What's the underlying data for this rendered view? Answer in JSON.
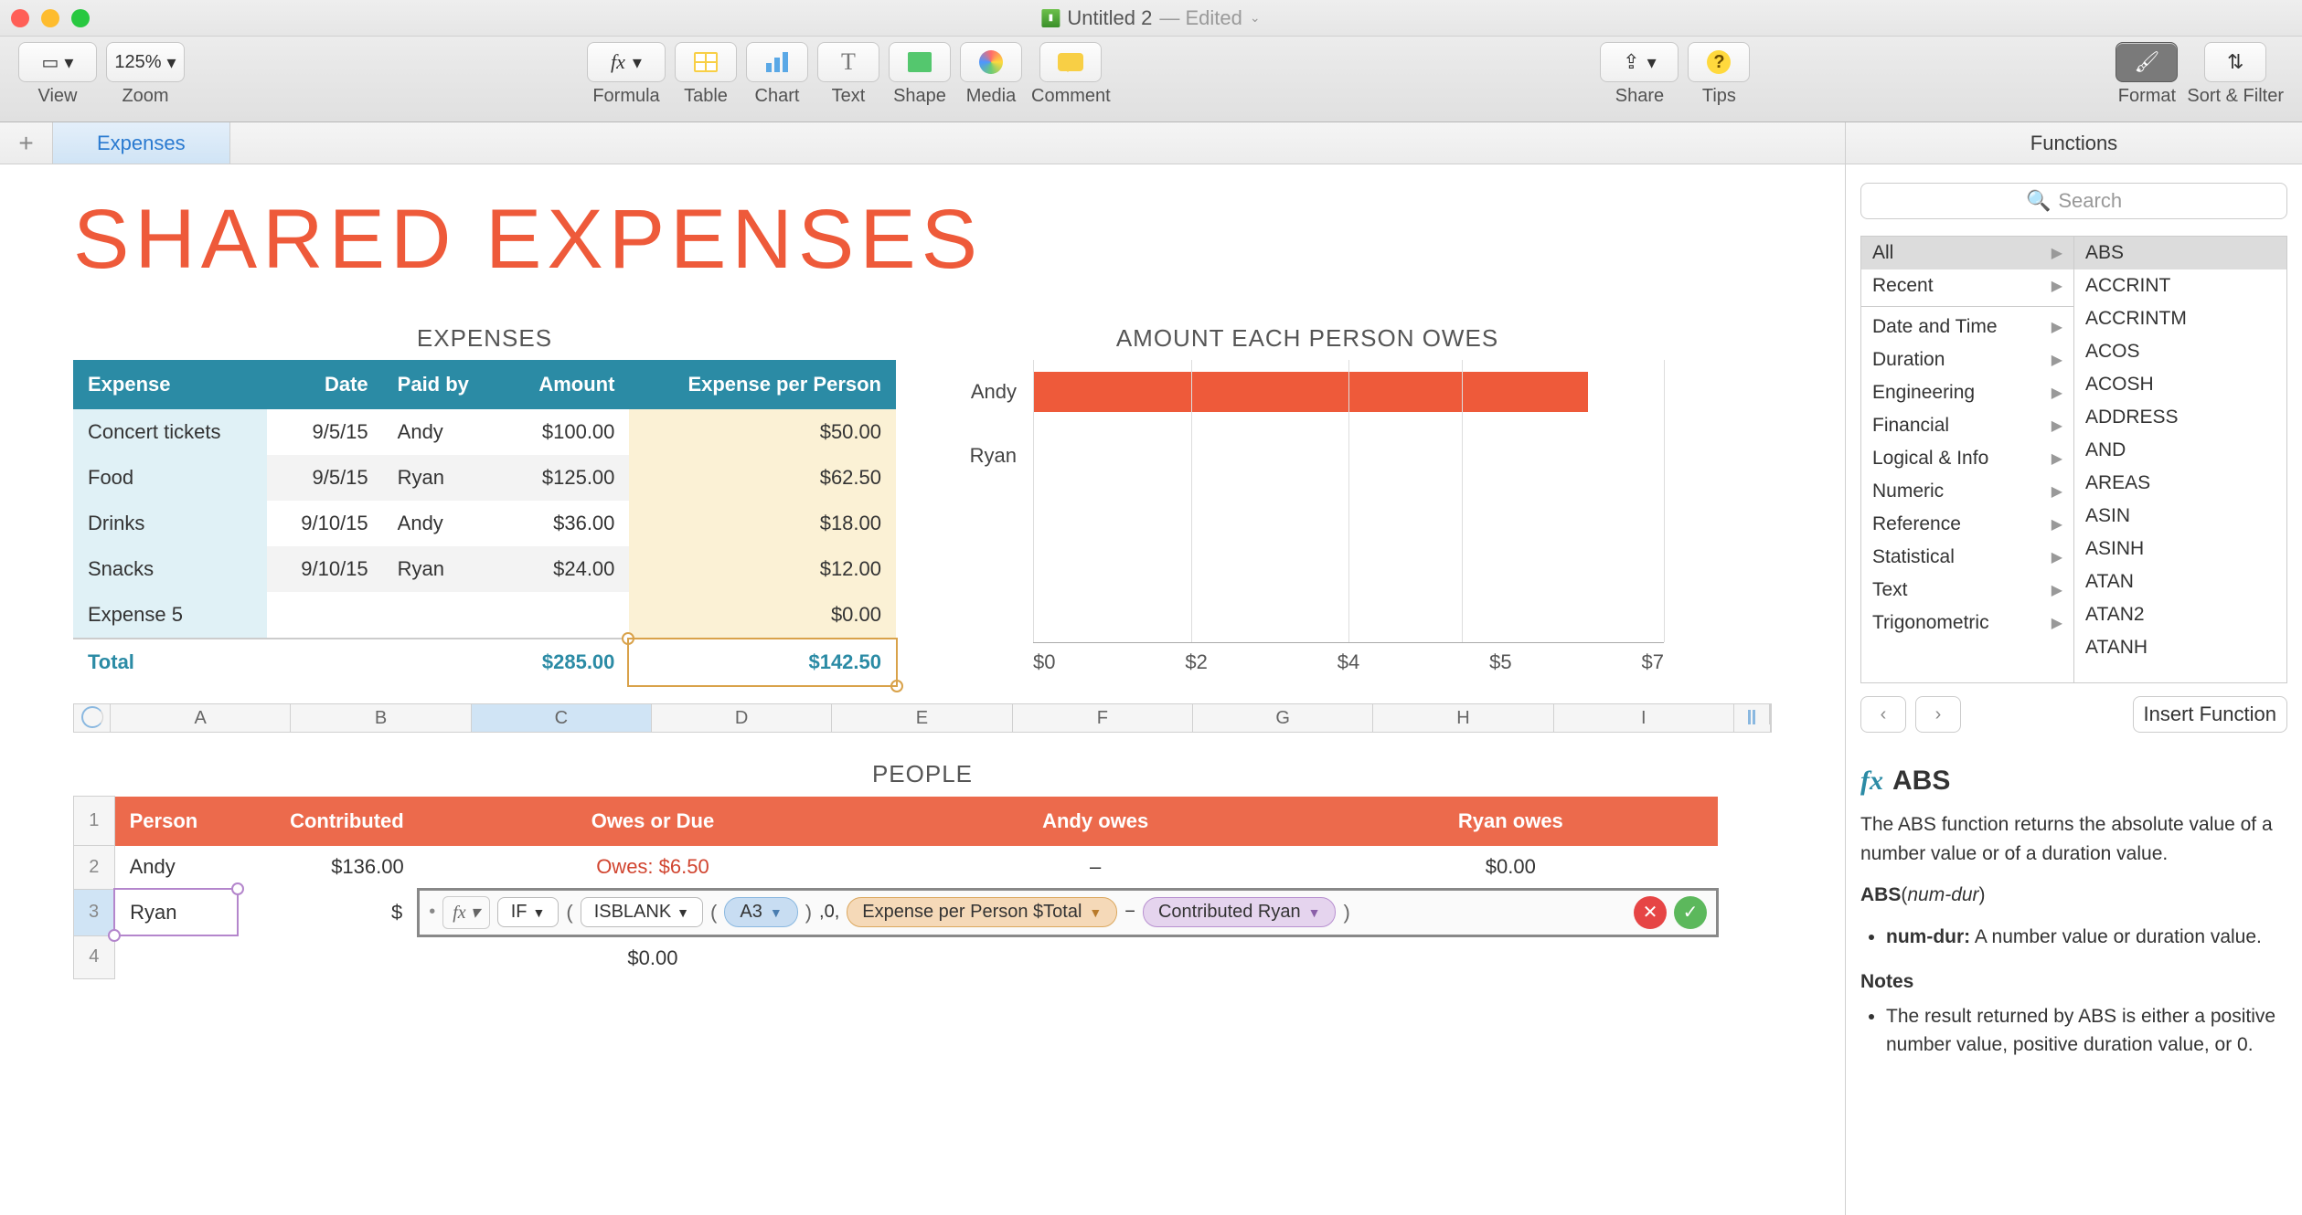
{
  "window": {
    "title": "Untitled 2",
    "edited": "— Edited"
  },
  "toolbar": {
    "view": "View",
    "zoom_label": "Zoom",
    "zoom_value": "125%",
    "formula": "Formula",
    "table": "Table",
    "chart": "Chart",
    "text": "Text",
    "shape": "Shape",
    "media": "Media",
    "comment": "Comment",
    "share": "Share",
    "tips": "Tips",
    "format": "Format",
    "sort": "Sort & Filter"
  },
  "tabs": {
    "active": "Expenses",
    "panel_title": "Functions"
  },
  "doc_title": "SHARED EXPENSES",
  "expenses": {
    "title": "EXPENSES",
    "headers": [
      "Expense",
      "Date",
      "Paid by",
      "Amount",
      "Expense per Person"
    ],
    "rows": [
      {
        "name": "Concert tickets",
        "date": "9/5/15",
        "paid": "Andy",
        "amount": "$100.00",
        "epp": "$50.00"
      },
      {
        "name": "Food",
        "date": "9/5/15",
        "paid": "Ryan",
        "amount": "$125.00",
        "epp": "$62.50"
      },
      {
        "name": "Drinks",
        "date": "9/10/15",
        "paid": "Andy",
        "amount": "$36.00",
        "epp": "$18.00"
      },
      {
        "name": "Snacks",
        "date": "9/10/15",
        "paid": "Ryan",
        "amount": "$24.00",
        "epp": "$12.00"
      },
      {
        "name": "Expense 5",
        "date": "",
        "paid": "",
        "amount": "",
        "epp": "$0.00"
      }
    ],
    "total_label": "Total",
    "total_amount": "$285.00",
    "total_epp": "$142.50"
  },
  "chart": {
    "title": "AMOUNT EACH PERSON OWES",
    "rows": [
      {
        "label": "Andy",
        "pct": 88
      },
      {
        "label": "Ryan",
        "pct": 0
      }
    ],
    "ticks": [
      "$0",
      "$2",
      "$4",
      "$5",
      "$7"
    ]
  },
  "chart_data": {
    "type": "bar",
    "orientation": "horizontal",
    "categories": [
      "Andy",
      "Ryan"
    ],
    "values": [
      6.5,
      0
    ],
    "title": "AMOUNT EACH PERSON OWES",
    "xlabel": "",
    "ylabel": "",
    "xlim": [
      0,
      7
    ],
    "xticks": [
      0,
      2,
      4,
      5,
      7
    ]
  },
  "cols": [
    "A",
    "B",
    "C",
    "D",
    "E",
    "F",
    "G",
    "H",
    "I"
  ],
  "people": {
    "title": "PEOPLE",
    "headers": [
      "Person",
      "Contributed",
      "Owes or Due",
      "Andy owes",
      "Ryan owes"
    ],
    "rows": [
      {
        "n": "2",
        "person": "Andy",
        "contrib": "$136.00",
        "owes": "Owes: $6.50",
        "a": "–",
        "r": "$0.00"
      },
      {
        "n": "3",
        "person": "Ryan",
        "contrib": "$",
        "owes": "",
        "a": "",
        "r": ""
      },
      {
        "n": "4",
        "person": "",
        "contrib": "",
        "owes": "$0.00",
        "a": "",
        "r": ""
      }
    ]
  },
  "formula": {
    "fn": "IF",
    "arg_fn": "ISBLANK",
    "ref": "A3",
    "literal": ",0,",
    "tok1": "Expense per Person $Total",
    "minus": "−",
    "tok2": "Contributed Ryan"
  },
  "sidebar": {
    "search_placeholder": "Search",
    "categories": [
      "All",
      "Recent",
      "",
      "Date and Time",
      "Duration",
      "Engineering",
      "Financial",
      "Logical & Info",
      "Numeric",
      "Reference",
      "Statistical",
      "Text",
      "Trigonometric"
    ],
    "functions": [
      "ABS",
      "ACCRINT",
      "ACCRINTM",
      "ACOS",
      "ACOSH",
      "ADDRESS",
      "AND",
      "AREAS",
      "ASIN",
      "ASINH",
      "ATAN",
      "ATAN2",
      "ATANH"
    ],
    "insert": "Insert Function",
    "help": {
      "name": "ABS",
      "desc": "The ABS function returns the absolute value of a number value or of a duration value.",
      "sig_fn": "ABS",
      "sig_arg": "num-dur",
      "arg_name": "num-dur:",
      "arg_desc": "A number value or duration value.",
      "notes_h": "Notes",
      "note1": "The result returned by ABS is either a positive number value, positive duration value, or 0."
    }
  }
}
